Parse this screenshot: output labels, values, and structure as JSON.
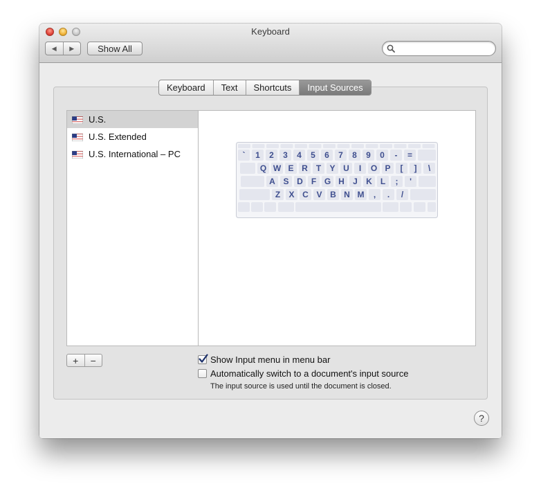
{
  "window": {
    "title": "Keyboard"
  },
  "toolbar": {
    "back_icon": "◀",
    "forward_icon": "▶",
    "show_all_label": "Show All",
    "search_placeholder": ""
  },
  "tabs": [
    {
      "label": "Keyboard",
      "selected": false
    },
    {
      "label": "Text",
      "selected": false
    },
    {
      "label": "Shortcuts",
      "selected": false
    },
    {
      "label": "Input Sources",
      "selected": true
    }
  ],
  "input_sources": [
    {
      "label": "U.S.",
      "icon": "us-flag-icon",
      "selected": true
    },
    {
      "label": "U.S. Extended",
      "icon": "us-flag-icon",
      "selected": false
    },
    {
      "label": "U.S. International – PC",
      "icon": "us-flag-icon",
      "selected": false
    }
  ],
  "keyboard_preview": {
    "rows": [
      [
        "`",
        "1",
        "2",
        "3",
        "4",
        "5",
        "6",
        "7",
        "8",
        "9",
        "0",
        "-",
        "="
      ],
      [
        "Q",
        "W",
        "E",
        "R",
        "T",
        "Y",
        "U",
        "I",
        "O",
        "P",
        "[",
        "]",
        "\\"
      ],
      [
        "A",
        "S",
        "D",
        "F",
        "G",
        "H",
        "J",
        "K",
        "L",
        ";",
        "'"
      ],
      [
        "Z",
        "X",
        "C",
        "V",
        "B",
        "N",
        "M",
        ",",
        ".",
        "/"
      ]
    ]
  },
  "list_controls": {
    "add_label": "+",
    "remove_label": "−"
  },
  "options": {
    "show_input_menu": {
      "label": "Show Input menu in menu bar",
      "checked": true
    },
    "auto_switch": {
      "label": "Automatically switch to a document's input source",
      "checked": false
    },
    "note": "The input source is used until the document is closed."
  },
  "help_label": "?",
  "colors": {
    "selected_tab": "#868686",
    "key_label": "#3f4f8f",
    "key_fill": "#e4e6ee",
    "selection_row": "#d3d3d3"
  }
}
